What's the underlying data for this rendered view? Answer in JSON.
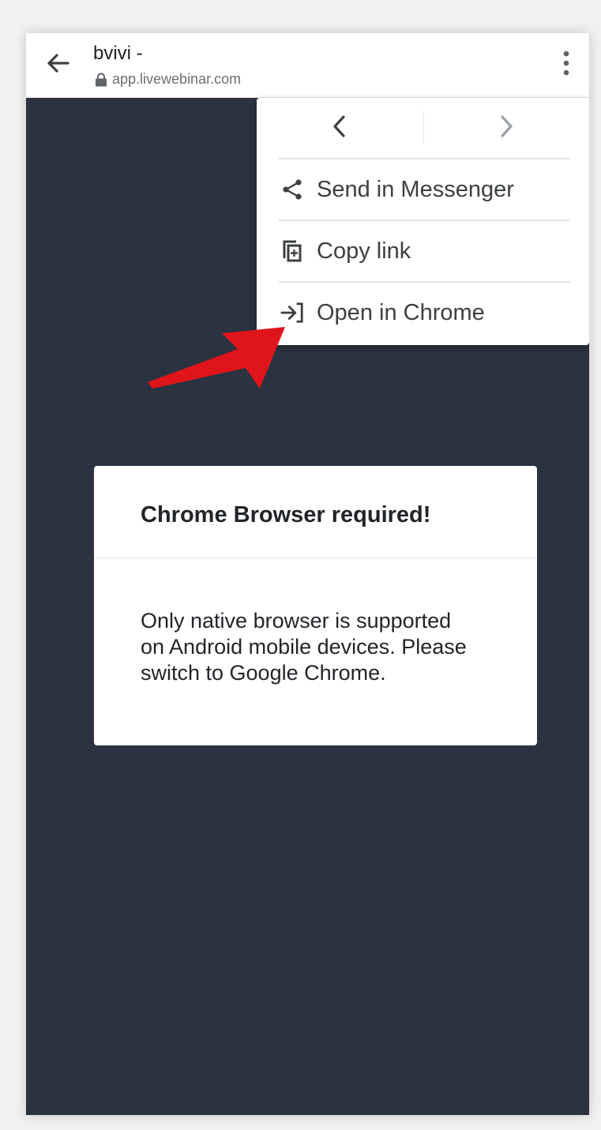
{
  "header": {
    "title": "bvivi -",
    "url": "app.livewebinar.com",
    "icons": {
      "back": "arrow-left-icon",
      "lock": "lock-icon",
      "more": "more-vertical-icon"
    }
  },
  "menu": {
    "nav": {
      "back_icon": "chevron-left-icon",
      "forward_icon": "chevron-right-icon"
    },
    "items": [
      {
        "label": "Send in Messenger",
        "icon": "share-icon"
      },
      {
        "label": "Copy link",
        "icon": "copy-icon"
      },
      {
        "label": "Open in Chrome",
        "icon": "open-external-icon"
      }
    ]
  },
  "annotation": {
    "icon": "red-arrow-icon",
    "color": "#e0141b"
  },
  "dialog": {
    "title": "Chrome Browser required!",
    "body_lines": [
      "Only native browser is supported",
      "on Android mobile devices. Please",
      "switch to Google Chrome."
    ]
  },
  "colors": {
    "page_background": "#2b3240",
    "toolbar": "#ffffff",
    "menu_text": "#3c4043"
  }
}
